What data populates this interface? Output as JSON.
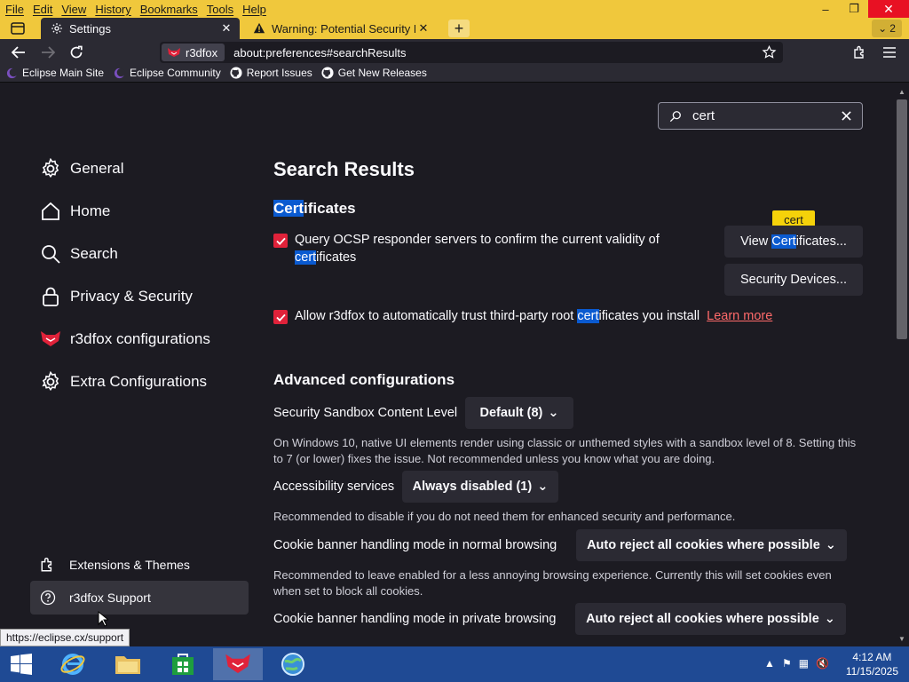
{
  "menubar": {
    "items": [
      "File",
      "Edit",
      "View",
      "History",
      "Bookmarks",
      "Tools",
      "Help"
    ]
  },
  "window_controls": {
    "minimize": "–",
    "restore": "❐",
    "close": "✕"
  },
  "tabs": [
    {
      "title": "Settings",
      "icon": "gear-icon",
      "active": true
    },
    {
      "title": "Warning: Potential Security Risk",
      "icon": "warning-icon",
      "active": false
    }
  ],
  "tab_count": "2",
  "navbar": {
    "identity_label": "r3dfox",
    "url": "about:preferences#searchResults"
  },
  "bookmarks": [
    {
      "label": "Eclipse Main Site",
      "icon": "eclipse-icon"
    },
    {
      "label": "Eclipse Community",
      "icon": "eclipse-icon"
    },
    {
      "label": "Report Issues",
      "icon": "github-icon"
    },
    {
      "label": "Get New Releases",
      "icon": "github-icon"
    }
  ],
  "search": {
    "value": "cert"
  },
  "sidebar": {
    "categories": [
      {
        "label": "General",
        "icon": "gear-icon"
      },
      {
        "label": "Home",
        "icon": "home-icon"
      },
      {
        "label": "Search",
        "icon": "search-icon"
      },
      {
        "label": "Privacy & Security",
        "icon": "lock-icon"
      },
      {
        "label": "r3dfox configurations",
        "icon": "r3dfox-icon"
      },
      {
        "label": "Extra Configurations",
        "icon": "gear-icon"
      }
    ],
    "footer": [
      {
        "label": "Extensions & Themes",
        "icon": "puzzle-icon"
      },
      {
        "label": "r3dfox Support",
        "icon": "help-icon"
      }
    ]
  },
  "main": {
    "title": "Search Results",
    "certificates": {
      "heading_hl": "Cert",
      "heading_rest": "ificates",
      "ocsp_line1": "Query OCSP responder servers to confirm the current validity of",
      "ocsp_hl": "cert",
      "ocsp_rest": "ificates",
      "ocsp_checked": true,
      "trust_pre": "Allow r3dfox to automatically trust third-party root ",
      "trust_hl": "cert",
      "trust_post": "ificates you install",
      "trust_checked": true,
      "learn_more": "Learn more",
      "view_btn_pre": "View ",
      "view_btn_hl": "Cert",
      "view_btn_post": "ificates...",
      "devices_btn": "Security Devices...",
      "tooltip": "cert"
    },
    "advanced": {
      "heading": "Advanced configurations",
      "sandbox_label": "Security Sandbox Content Level",
      "sandbox_value": "Default (8)",
      "sandbox_desc": "On Windows 10, native UI elements render using classic or unthemed styles with a sandbox level of 8. Setting this to 7 (or lower) fixes the issue. Not recommended unless you know what you are doing.",
      "a11y_label": "Accessibility services",
      "a11y_value": "Always disabled (1)",
      "a11y_desc": "Recommended to disable if you do not need them for enhanced security and performance.",
      "cookie_normal_label": "Cookie banner handling mode in normal browsing",
      "cookie_normal_value": "Auto reject all cookies where possible",
      "cookie_normal_desc": "Recommended to leave enabled for a less annoying browsing experience. Currently this will set cookies even when set to block all cookies.",
      "cookie_private_label": "Cookie banner handling mode in private browsing",
      "cookie_private_value": "Auto reject all cookies where possible"
    }
  },
  "status_url": "https://eclipse.cx/support",
  "taskbar": {
    "time": "4:12 AM",
    "date": "11/15/2025"
  },
  "colors": {
    "titlebar": "#f0c83c",
    "background": "#1c1b22",
    "checkbox": "#e0223a",
    "highlight": "#0a5ad0",
    "link": "#ff6a6a",
    "taskbar": "#1f4a94"
  }
}
